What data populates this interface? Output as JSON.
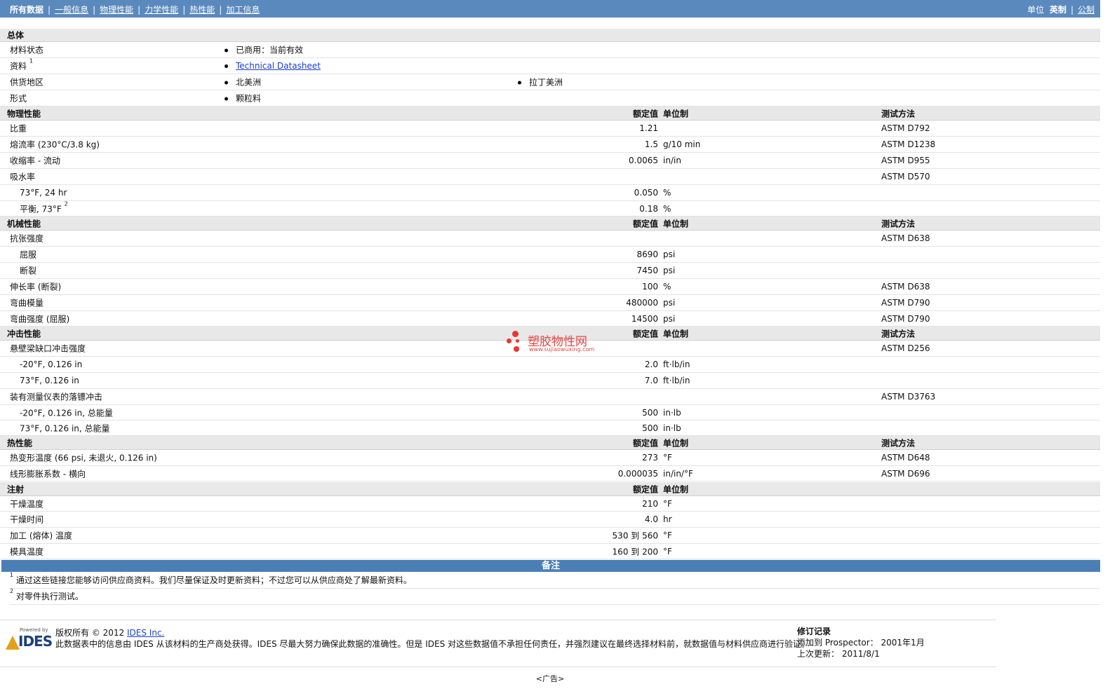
{
  "nav": {
    "all_data": "所有数据",
    "links": [
      "一般信息",
      "物理性能",
      "力学性能",
      "热性能",
      "加工信息"
    ],
    "unit_label": "单位",
    "unit_imperial": "英制",
    "unit_metric": "公制"
  },
  "general": {
    "title": "总体",
    "status_label": "材料状态",
    "status_value": "已商用：当前有效",
    "source_label": "资料",
    "source_sup": "1",
    "source_link": "Technical Datasheet",
    "region_label": "供货地区",
    "region_1": "北美洲",
    "region_2": "拉丁美洲",
    "form_label": "形式",
    "form_value": "颗粒料"
  },
  "headers": {
    "value": "额定值",
    "unit": "单位制",
    "method": "测试方法"
  },
  "physical": {
    "title": "物理性能",
    "rows": [
      {
        "label": "比重",
        "value": "1.21",
        "unit": "",
        "method": "ASTM D792"
      },
      {
        "label": "熔流率  (230°C/3.8 kg)",
        "value": "1.5",
        "unit": "g/10 min",
        "method": "ASTM D1238"
      },
      {
        "label": "收缩率  - 流动",
        "value": "0.0065",
        "unit": "in/in",
        "method": "ASTM D955"
      },
      {
        "label": "吸水率",
        "value": "",
        "unit": "",
        "method": "ASTM D570"
      },
      {
        "label": "73°F, 24 hr",
        "value": "0.050",
        "unit": "%",
        "method": ""
      },
      {
        "label": "平衡, 73°F",
        "sup": "2",
        "value": "0.18",
        "unit": "%",
        "method": ""
      }
    ]
  },
  "mechanical": {
    "title": "机械性能",
    "rows": [
      {
        "label": "抗张强度",
        "value": "",
        "unit": "",
        "method": "ASTM D638"
      },
      {
        "label": "屈服",
        "value": "8690",
        "unit": "psi",
        "method": ""
      },
      {
        "label": "断裂",
        "value": "7450",
        "unit": "psi",
        "method": ""
      },
      {
        "label": "伸长率  (断裂)",
        "value": "100",
        "unit": "%",
        "method": "ASTM D638"
      },
      {
        "label": "弯曲模量",
        "value": "480000",
        "unit": "psi",
        "method": "ASTM D790"
      },
      {
        "label": "弯曲强度  (屈服)",
        "value": "14500",
        "unit": "psi",
        "method": "ASTM D790"
      }
    ]
  },
  "impact": {
    "title": "冲击性能",
    "rows": [
      {
        "label": "悬壁梁缺口冲击强度",
        "value": "",
        "unit": "",
        "method": "ASTM D256"
      },
      {
        "label": "-20°F, 0.126 in",
        "value": "2.0",
        "unit": "ft·lb/in",
        "method": ""
      },
      {
        "label": "73°F, 0.126 in",
        "value": "7.0",
        "unit": "ft·lb/in",
        "method": ""
      },
      {
        "label": "装有测量仪表的落镖冲击",
        "value": "",
        "unit": "",
        "method": "ASTM D3763"
      },
      {
        "label": "-20°F, 0.126 in, 总能量",
        "value": "500",
        "unit": "in·lb",
        "method": ""
      },
      {
        "label": "73°F, 0.126 in, 总能量",
        "value": "500",
        "unit": "in·lb",
        "method": ""
      }
    ]
  },
  "thermal": {
    "title": "热性能",
    "rows": [
      {
        "label": "热变形温度  (66 psi, 未退火, 0.126 in)",
        "value": "273",
        "unit": "°F",
        "method": "ASTM D648"
      },
      {
        "label": "线形膨胀系数  - 横向",
        "value": "0.000035",
        "unit": "in/in/°F",
        "method": "ASTM D696"
      }
    ]
  },
  "injection": {
    "title": "注射",
    "rows": [
      {
        "label": "干燥温度",
        "value": "210",
        "unit": "°F"
      },
      {
        "label": "干燥时间",
        "value": "4.0",
        "unit": "hr"
      },
      {
        "label": "加工 (熔体) 温度",
        "value": "530 到  560",
        "unit": "°F"
      },
      {
        "label": "模具温度",
        "value": "160 到  200",
        "unit": "°F"
      }
    ]
  },
  "notes": {
    "title": "备注",
    "items": [
      {
        "num": "1",
        "text": "通过这些链接您能够访问供应商资料。我们尽量保证及时更新资料；不过您可以从供应商处了解最新资料。"
      },
      {
        "num": "2",
        "text": "对零件执行测试。"
      }
    ]
  },
  "watermark": {
    "name": "塑胶物性网",
    "url": "www.sujiaowuxing.com"
  },
  "footer": {
    "logo_powered": "Powered by",
    "logo_name": "IDES",
    "copyright": "版权所有  © 2012",
    "company_link": "IDES Inc.",
    "disclaimer": "此数据表中的信息由  IDES 从该材料的生产商处获得。IDES 尽最大努力确保此数据的准确性。但是  IDES 对这些数据值不承担任何责任，并强烈建议在最终选择材料前，就数据值与材料供应商进行验证。",
    "revision_title": "修订记录",
    "added_label": "添加到  Prospector：",
    "added_value": "2001年1月",
    "updated_label": "上次更新：",
    "updated_value": "2011/8/1"
  },
  "ad": "<广告>"
}
